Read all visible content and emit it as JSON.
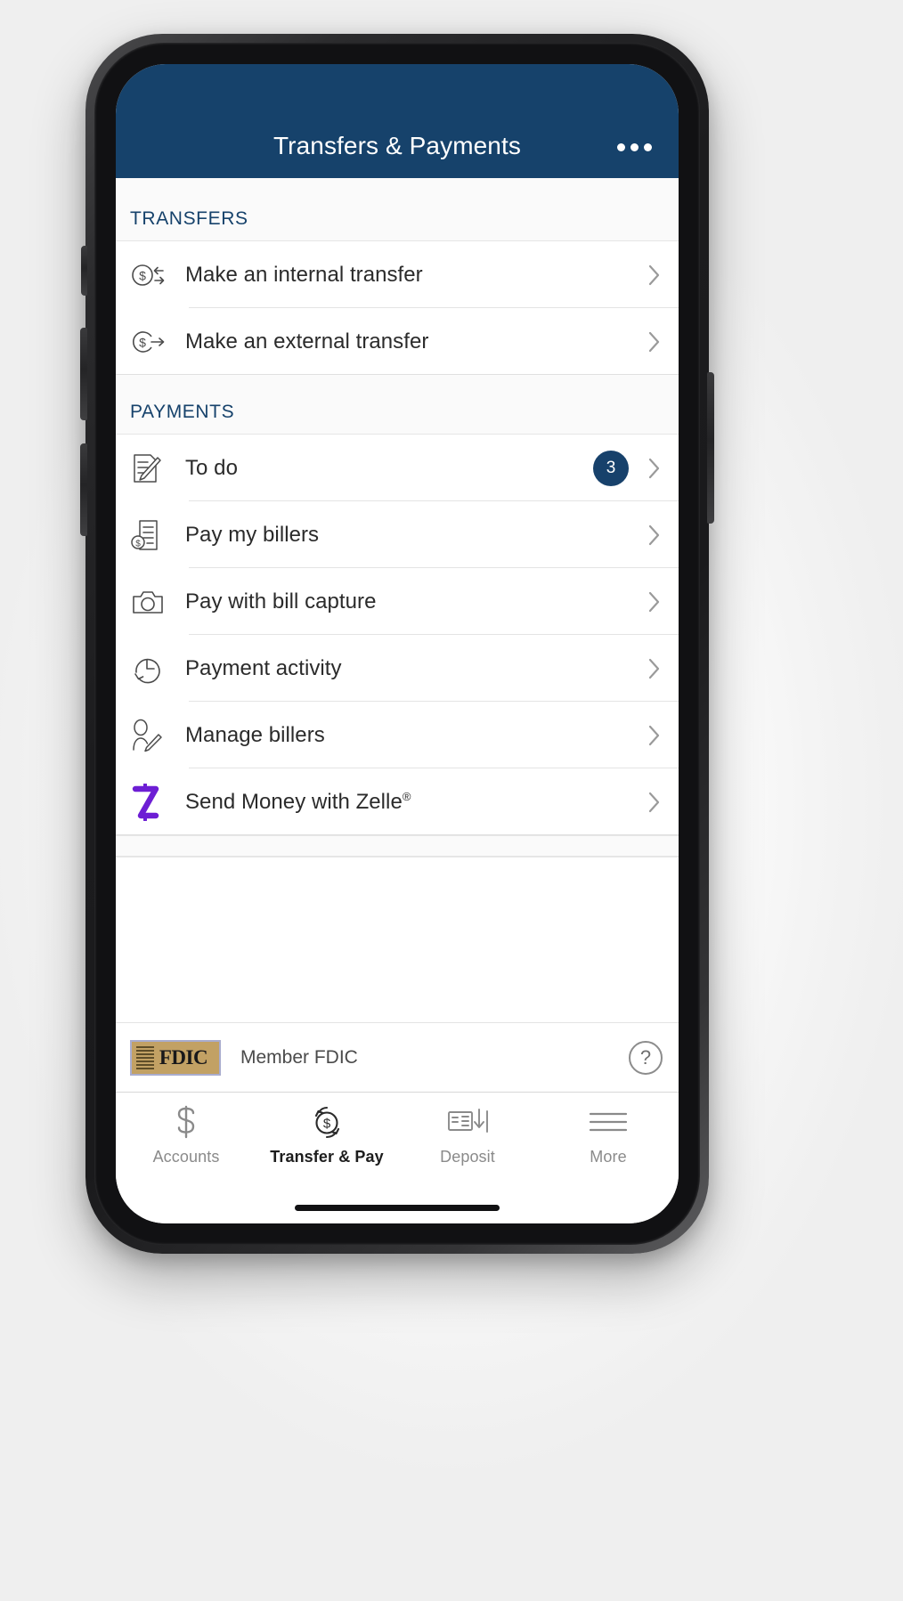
{
  "header": {
    "title": "Transfers & Payments",
    "overflow_menu": "overflow-menu",
    "background_color": "#16426b"
  },
  "sections": [
    {
      "title": "TRANSFERS",
      "items": [
        {
          "label": "Make an internal transfer",
          "icon": "dollar-circle-exchange-icon",
          "badge": null
        },
        {
          "label": "Make an external transfer",
          "icon": "dollar-circle-arrow-right-icon",
          "badge": null
        }
      ]
    },
    {
      "title": "PAYMENTS",
      "items": [
        {
          "label": "To do",
          "icon": "document-pen-icon",
          "badge": "3"
        },
        {
          "label": "Pay my billers",
          "icon": "invoice-dollar-icon",
          "badge": null
        },
        {
          "label": "Pay with bill capture",
          "icon": "camera-icon",
          "badge": null
        },
        {
          "label": "Payment activity",
          "icon": "clock-history-icon",
          "badge": null
        },
        {
          "label": "Manage billers",
          "icon": "person-pen-icon",
          "badge": null
        },
        {
          "label": "Send Money with Zelle",
          "label_sup": "®",
          "icon": "zelle-z-icon",
          "badge": null
        }
      ]
    }
  ],
  "footer": {
    "fdic_logo_text": "FDIC",
    "member_text": "Member FDIC",
    "help_icon_label": "?"
  },
  "tabbar": {
    "tabs": [
      {
        "label": "Accounts",
        "icon": "dollar-sign-icon",
        "active": false
      },
      {
        "label": "Transfer & Pay",
        "icon": "transfer-circle-icon",
        "active": true
      },
      {
        "label": "Deposit",
        "icon": "check-deposit-icon",
        "active": false
      },
      {
        "label": "More",
        "icon": "hamburger-menu-icon",
        "active": false
      }
    ]
  },
  "colors": {
    "brand_navy": "#16426b",
    "badge_navy": "#17416b",
    "zelle_purple": "#6d1ed4",
    "fdic_gold": "#c2a164"
  }
}
